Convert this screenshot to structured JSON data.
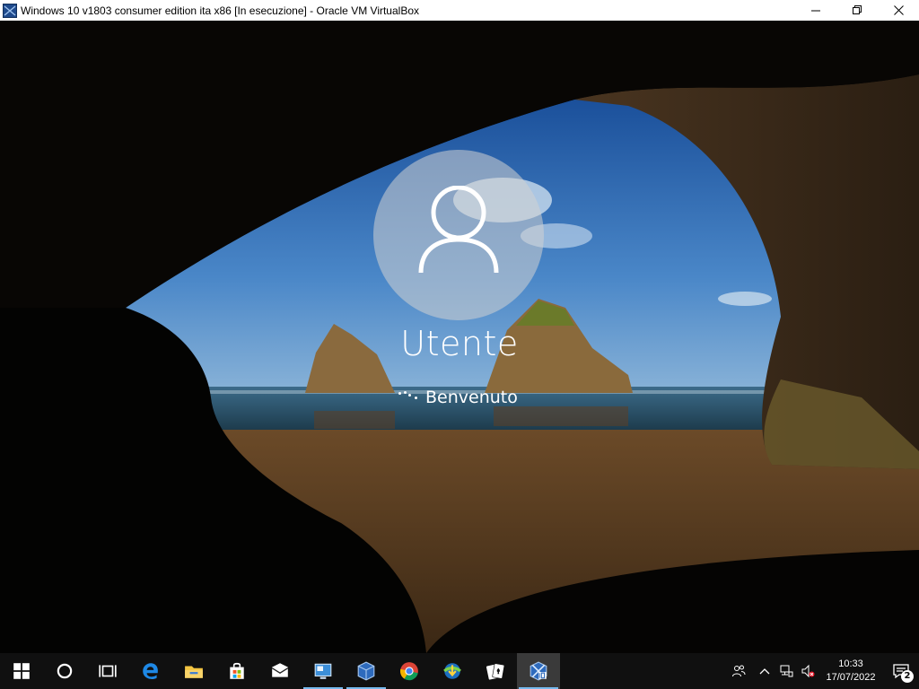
{
  "window": {
    "title": "Windows 10 v1803 consumer edition ita x86 [In esecuzione] - Oracle VM VirtualBox",
    "app_icon": "virtualbox-icon"
  },
  "lock_screen": {
    "user_name": "Utente",
    "status_text": "Benvenuto",
    "avatar_icon": "user-icon"
  },
  "taskbar": {
    "items": [
      {
        "name": "start-icon"
      },
      {
        "name": "cortana-icon"
      },
      {
        "name": "task-view-icon"
      },
      {
        "name": "edge-icon"
      },
      {
        "name": "file-explorer-icon"
      },
      {
        "name": "store-icon"
      },
      {
        "name": "mail-icon"
      },
      {
        "name": "remote-desktop-icon"
      },
      {
        "name": "virtualbox-icon"
      },
      {
        "name": "chrome-icon"
      },
      {
        "name": "download-manager-icon"
      },
      {
        "name": "solitaire-icon"
      },
      {
        "name": "windows10-vm-icon"
      }
    ],
    "tray": {
      "time": "10:33",
      "date": "17/07/2022",
      "notification_count": "2"
    }
  },
  "colors": {
    "taskbar_bg": "#101010",
    "accent": "#76b9ed",
    "sky": "#2b6db4",
    "sand": "#5a3e22"
  }
}
